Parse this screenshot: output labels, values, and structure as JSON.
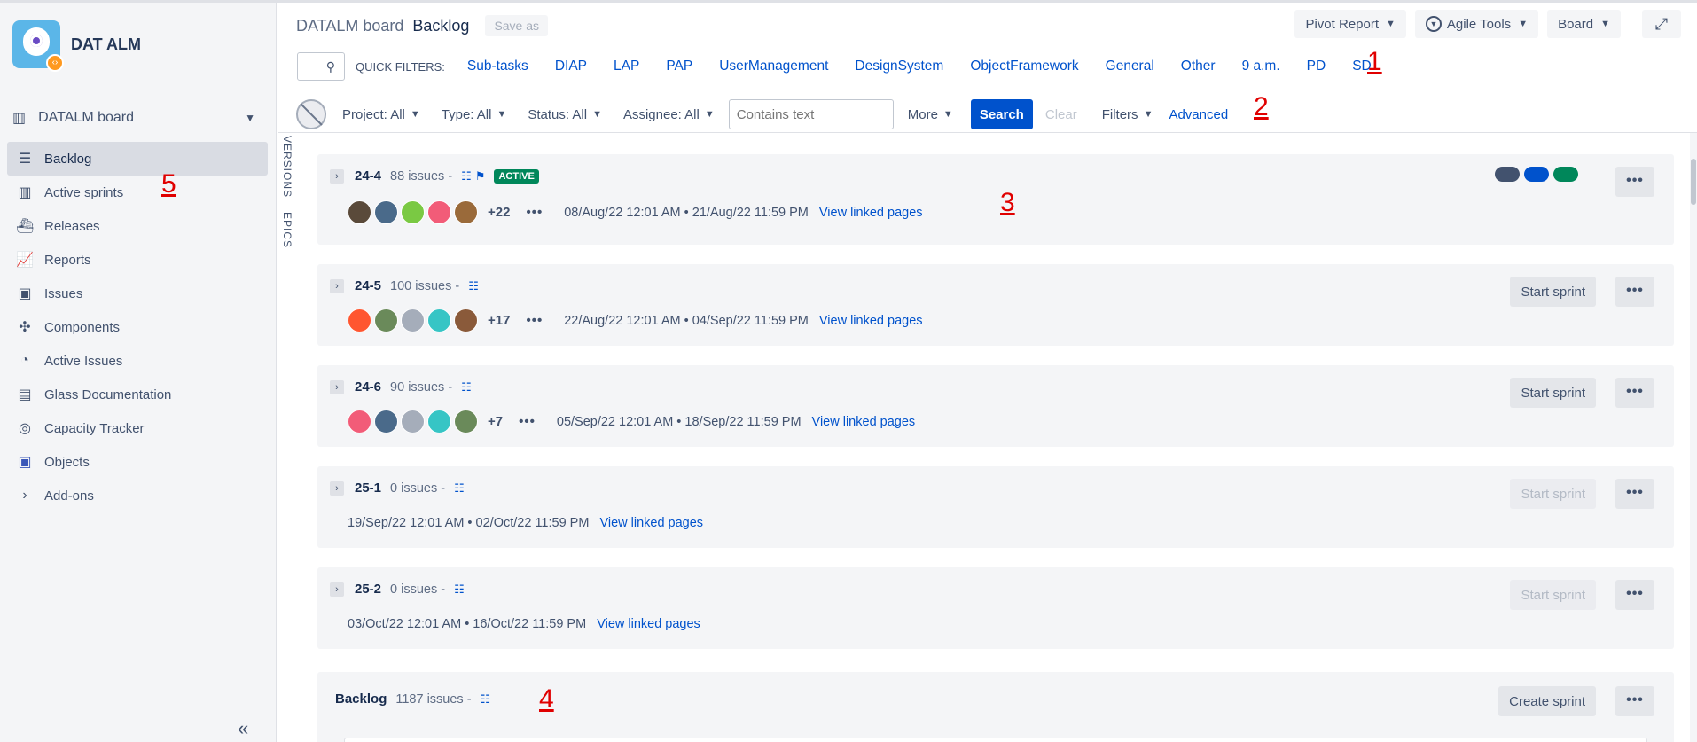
{
  "project": {
    "name": "DAT ALM",
    "badge_icon": "code-icon"
  },
  "sidebar": {
    "board_select": "DATALM board",
    "items": [
      {
        "label": "Backlog",
        "icon": "backlog-icon",
        "active": true
      },
      {
        "label": "Active sprints",
        "icon": "columns-icon"
      },
      {
        "label": "Releases",
        "icon": "ship-icon"
      },
      {
        "label": "Reports",
        "icon": "chart-icon"
      },
      {
        "label": "Issues",
        "icon": "monitor-icon"
      },
      {
        "label": "Components",
        "icon": "puzzle-icon"
      },
      {
        "label": "Active Issues",
        "icon": "clock-icon"
      },
      {
        "label": "Glass Documentation",
        "icon": "document-icon"
      },
      {
        "label": "Capacity Tracker",
        "icon": "gauge-icon"
      },
      {
        "label": "Objects",
        "icon": "objects-icon"
      },
      {
        "label": "Add-ons",
        "icon": "chevron-right-icon"
      }
    ],
    "collapse_label": "«"
  },
  "side_tabs": [
    "VERSIONS",
    "EPICS"
  ],
  "header": {
    "board": "DATALM board",
    "page": "Backlog",
    "save_as": "Save as",
    "buttons": {
      "pivot": "Pivot Report",
      "agile": "Agile Tools",
      "board": "Board",
      "expand_icon": "expand-icon"
    }
  },
  "quick_filters": {
    "label": "QUICK FILTERS:",
    "items": [
      "Sub-tasks",
      "DIAP",
      "LAP",
      "PAP",
      "UserManagement",
      "DesignSystem",
      "ObjectFramework",
      "General",
      "Other",
      "9 a.m.",
      "PD",
      "SD"
    ]
  },
  "filters": {
    "project": "Project: All",
    "type": "Type: All",
    "status": "Status: All",
    "assignee": "Assignee: All",
    "text_placeholder": "Contains text",
    "more": "More",
    "search": "Search",
    "clear": "Clear",
    "filters": "Filters",
    "advanced": "Advanced"
  },
  "annotations": [
    "1",
    "2",
    "3",
    "4",
    "5"
  ],
  "colors": {
    "accent": "#0052cc",
    "active_badge": "#00875a",
    "annotation": "#e00000",
    "pills": [
      "#42526e",
      "#0052cc",
      "#00875a"
    ]
  },
  "sprints": [
    {
      "name": "24-4",
      "count": "88 issues -",
      "active": "ACTIVE",
      "extra_avatars": "+22",
      "dates": "08/Aug/22 12:01 AM • 21/Aug/22 11:59 PM",
      "link": "View linked pages"
    },
    {
      "name": "24-5",
      "count": "100 issues -",
      "extra_avatars": "+17",
      "dates": "22/Aug/22 12:01 AM • 04/Sep/22 11:59 PM",
      "link": "View linked pages",
      "action": "Start sprint"
    },
    {
      "name": "24-6",
      "count": "90 issues -",
      "extra_avatars": "+7",
      "dates": "05/Sep/22 12:01 AM • 18/Sep/22 11:59 PM",
      "link": "View linked pages",
      "action": "Start sprint"
    },
    {
      "name": "25-1",
      "count": "0 issues -",
      "dates": "19/Sep/22 12:01 AM • 02/Oct/22 11:59 PM",
      "link": "View linked pages",
      "action": "Start sprint"
    },
    {
      "name": "25-2",
      "count": "0 issues -",
      "dates": "03/Oct/22 12:01 AM • 16/Oct/22 11:59 PM",
      "link": "View linked pages",
      "action": "Start sprint"
    }
  ],
  "backlog": {
    "name": "Backlog",
    "count": "1187 issues -",
    "action": "Create sprint"
  },
  "more_label": "•••"
}
